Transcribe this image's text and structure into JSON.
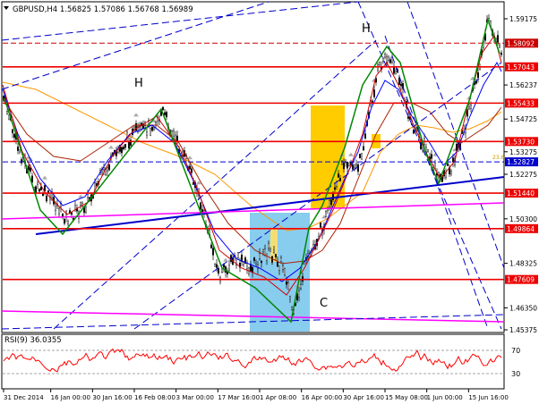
{
  "header": {
    "symbol_info": "GBPUSD,H4  1.56825 1.57086 1.56768 1.56989"
  },
  "price_axis": {
    "ticks": [
      "1.59175",
      "1.56237",
      "1.54725",
      "1.53275",
      "1.52275",
      "1.50300",
      "1.48325",
      "1.46350",
      "1.45375"
    ]
  },
  "levels": [
    {
      "value": "1.58092",
      "style": "dashed",
      "color": "#cc0000"
    },
    {
      "value": "1.57043",
      "style": "solid",
      "color": "#ee0000"
    },
    {
      "value": "1.55433",
      "style": "solid",
      "color": "#ee0000"
    },
    {
      "value": "1.53730",
      "style": "solid",
      "color": "#ee0000"
    },
    {
      "value": "1.52827",
      "style": "dashed",
      "color": "#0000cc"
    },
    {
      "value": "1.51440",
      "style": "solid",
      "color": "#ee0000"
    },
    {
      "value": "1.49864",
      "style": "solid",
      "color": "#ee0000"
    },
    {
      "value": "1.47609",
      "style": "solid",
      "color": "#ee0000"
    }
  ],
  "annotations": {
    "h_left": "H",
    "h_right": "H",
    "c_label": "C",
    "small_tag": "23.6"
  },
  "rsi": {
    "label": "RSI(9) 36.0355",
    "ticks": [
      "70",
      "30"
    ]
  },
  "time_axis": {
    "labels": [
      "31 Dec 2014",
      "16 Jan 00:00",
      "30 Jan 16:00",
      "16 Feb 08:00",
      "3 Mar 00:00",
      "17 Mar 16:00",
      "1 Apr 08:00",
      "16 Apr 00:00",
      "30 Apr 16:00",
      "15 May 08:00",
      "1 Jun 00:00",
      "15 Jun 16:00"
    ]
  },
  "colors": {
    "background": "#ffffff",
    "candles": "#000000",
    "level_line": "#ee0000",
    "ma_fast": "#0000ff",
    "ma_mid": "#aa2200",
    "ma_slow": "#ff9900",
    "zigzag": "#008800",
    "trend_blue": "#0000ff",
    "trend_magenta": "#ff00ff",
    "box_orange": "#ffcc00",
    "box_blue": "#88ccee",
    "rsi_line": "#ff0000"
  }
}
